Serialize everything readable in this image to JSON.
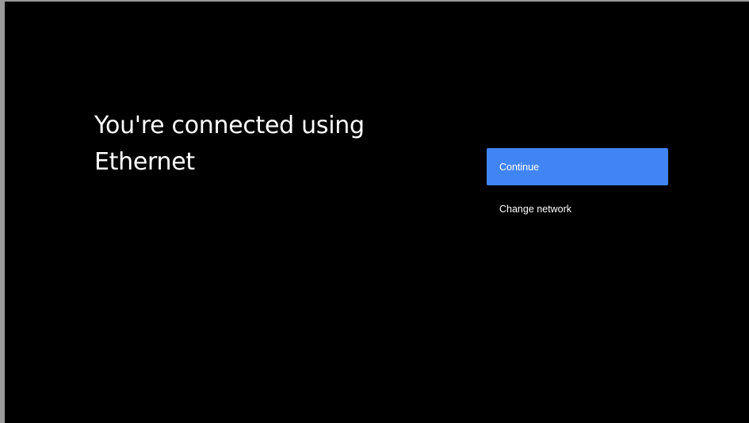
{
  "setup": {
    "heading": "You're connected using Ethernet",
    "continue_label": "Continue",
    "change_network_label": "Change network"
  },
  "colors": {
    "background": "#000000",
    "accent": "#4185f4",
    "text": "#ffffff"
  }
}
